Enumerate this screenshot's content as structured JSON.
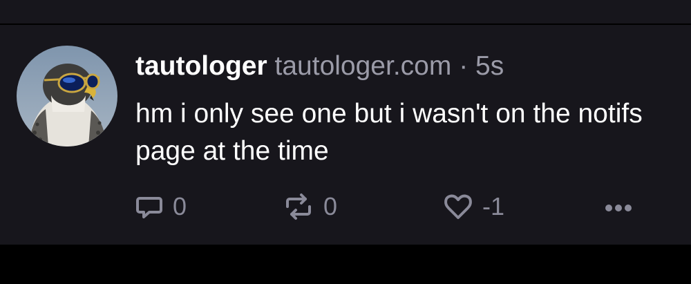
{
  "post": {
    "author": {
      "display_name": "tautologer",
      "handle": "tautologer.com"
    },
    "separator": "·",
    "timestamp": "5s",
    "text": "hm i only see one but i wasn't on the notifs page at the time",
    "actions": {
      "reply": {
        "icon": "speech-bubble-icon",
        "count": "0"
      },
      "repost": {
        "icon": "repost-icon",
        "count": "0"
      },
      "like": {
        "icon": "heart-icon",
        "count": "-1"
      },
      "more": {
        "icon": "ellipsis-icon"
      }
    }
  },
  "colors": {
    "background": "#17161c",
    "text_primary": "#ffffff",
    "text_secondary": "#9b9ba8",
    "icon": "#8a8a99"
  }
}
